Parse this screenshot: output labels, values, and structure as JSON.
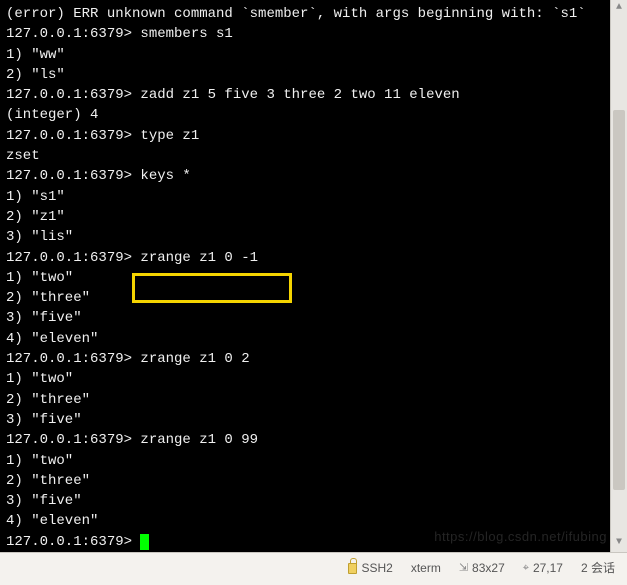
{
  "terminal": {
    "lines": [
      "(error) ERR unknown command `smember`, with args beginning with: `s1`",
      "127.0.0.1:6379> smembers s1",
      "1) \"ww\"",
      "2) \"ls\"",
      "127.0.0.1:6379> zadd z1 5 five 3 three 2 two 11 eleven",
      "(integer) 4",
      "127.0.0.1:6379> type z1",
      "zset",
      "127.0.0.1:6379> keys *",
      "1) \"s1\"",
      "2) \"z1\"",
      "3) \"lis\"",
      "127.0.0.1:6379> zrange z1 0 -1",
      "1) \"two\"",
      "2) \"three\"",
      "3) \"five\"",
      "4) \"eleven\"",
      "127.0.0.1:6379> zrange z1 0 2",
      "1) \"two\"",
      "2) \"three\"",
      "3) \"five\"",
      "127.0.0.1:6379> zrange z1 0 99",
      "1) \"two\"",
      "2) \"three\"",
      "3) \"five\"",
      "4) \"eleven\""
    ],
    "prompt": "127.0.0.1:6379> ",
    "highlighted_command": "zrange z1 0 -1"
  },
  "statusbar": {
    "protocol": "SSH2",
    "term_type": "xterm",
    "size": "83x27",
    "position": "27,17",
    "sessions": "2 会话"
  },
  "watermark": "https://blog.csdn.net/ifubing"
}
